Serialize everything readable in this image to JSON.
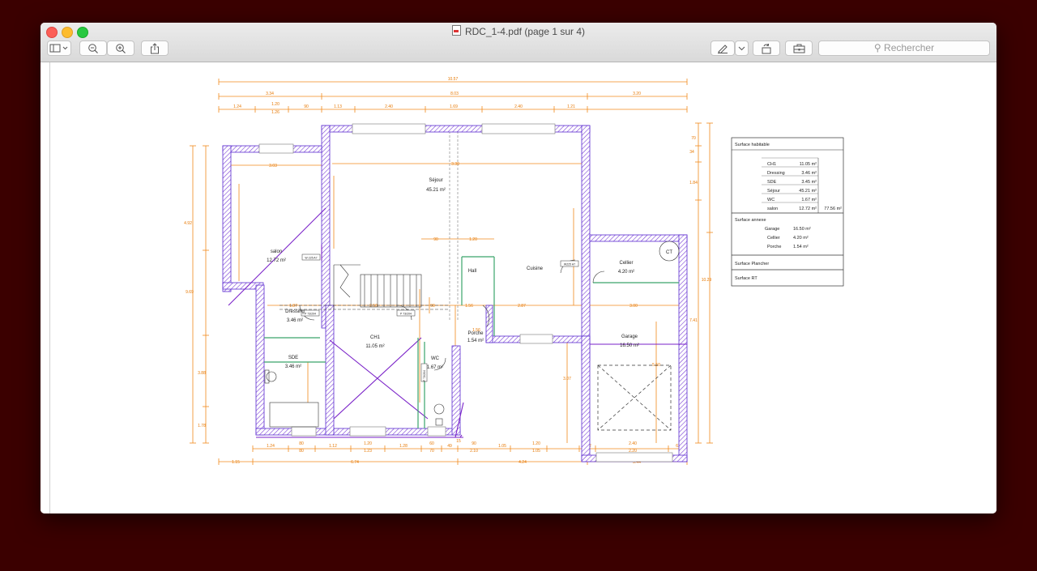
{
  "window": {
    "title": "RDC_1-4.pdf (page 1 sur 4)",
    "search_placeholder": "Rechercher"
  },
  "toolbar": {
    "left": [
      "sidebar-icon",
      "chevron-down-icon",
      "zoom-out-icon",
      "zoom-in-icon",
      "share-icon"
    ],
    "right": [
      "markup-pen-icon",
      "chevron-down-icon",
      "rotate-icon",
      "toolbox-icon"
    ]
  },
  "plan": {
    "rooms": {
      "sejour": {
        "name": "Séjour",
        "area": "45.21 m²"
      },
      "salon": {
        "name": "salon",
        "area": "12.72 m²"
      },
      "hall": {
        "name": "Hall"
      },
      "cuisine": {
        "name": "Cuisine"
      },
      "cellier": {
        "name": "Cellier",
        "area": "4.20 m²"
      },
      "dressing": {
        "name": "Dressing",
        "area": "3.46 m²"
      },
      "ch1": {
        "name": "CH1",
        "area": "11.05 m²"
      },
      "sde": {
        "name": "SDE",
        "area": "3.46 m²"
      },
      "wc": {
        "name": "WC",
        "area": "1.67 m²"
      },
      "porche": {
        "name": "Porche",
        "area": "1.54 m²"
      },
      "garage": {
        "name": "Garage",
        "area": "16.50 m²"
      },
      "ct": {
        "name": "CT"
      }
    },
    "dims_top": {
      "total": "10.57",
      "a": "3.34",
      "b": "8.03",
      "c": "3.20",
      "d1": "1.24",
      "d2": "1.20",
      "d2b": "1.26",
      "d3": "90",
      "d4": "1.13",
      "d5": "2.40",
      "d6": "1.69",
      "d7": "2.40",
      "d8": "1.21"
    },
    "dims_bottom": {
      "a1": "1.24",
      "a2": "80",
      "a2b": "80",
      "a3": "1.12",
      "a4": "1.20",
      "a4b": "1.23",
      "a5": "1.28",
      "a6": "60",
      "a6b": "70",
      "a7": "49",
      "a8": "15",
      "a9": "90",
      "a9b": "2.10",
      "a10": "1.05",
      "a11": "1.20",
      "a11b": "1.05",
      "a12": "52",
      "a13": "2.40",
      "a13b": "2.20",
      "a14": "62",
      "b1": "1.15",
      "b2": "6.74",
      "b3": "4.24",
      "b4": "3.44"
    },
    "dims_inner": {
      "d1": "3.03",
      "d2": "3.30",
      "d3": "90",
      "d4": "1.20",
      "d5": "1.87",
      "d6": "2.50",
      "d7": "90",
      "d8": "1.56",
      "d9": "2.87",
      "d10": "3.00",
      "d11": "1.56",
      "d12": "5.50",
      "d13": "3.07"
    },
    "dims_left": {
      "a": "4.92",
      "b": "9.69",
      "c": "3.88",
      "d": "1.78"
    },
    "dims_right": {
      "a": "70",
      "b": "34",
      "c": "1.84",
      "d": "10.29",
      "e": "7.41"
    },
    "door_tags": {
      "t1": "P 73/204",
      "t2": "P 73/204",
      "t3": "P 73/204",
      "w1": "W 225 A7",
      "w2": "W225 A7"
    }
  },
  "surface_table": {
    "habitable_title": "Surface habitable",
    "rows": [
      {
        "name": "CH1",
        "area": "11.05 m²"
      },
      {
        "name": "Dressing",
        "area": "3.46 m²"
      },
      {
        "name": "SDE",
        "area": "3.45 m²"
      },
      {
        "name": "Séjour",
        "area": "45.21 m²"
      },
      {
        "name": "WC",
        "area": "1.67 m²"
      },
      {
        "name": "salon",
        "area": "12.72 m²"
      }
    ],
    "habitable_total": "77.56 m²",
    "annexe_title": "Surface annexe",
    "annexe_rows": [
      {
        "name": "Garage",
        "area": "16.50 m²"
      },
      {
        "name": "Cellier",
        "area": "4.20 m²"
      },
      {
        "name": "Porche",
        "area": "1.54 m²"
      }
    ],
    "plancher_title": "Surface Plancher",
    "rt_title": "Surface RT"
  }
}
